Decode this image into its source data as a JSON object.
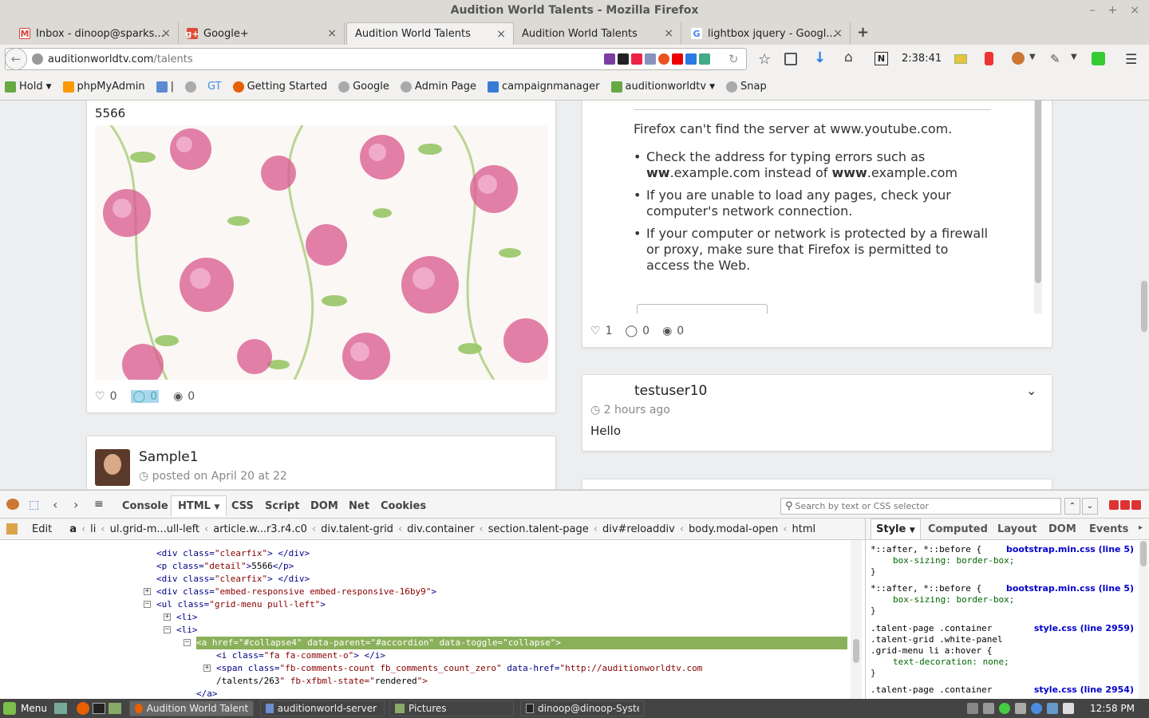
{
  "window": {
    "title": "Audition World Talents - Mozilla Firefox"
  },
  "tabs": [
    {
      "label": "Inbox - dinoop@sparks...",
      "icon": "gmail-icon",
      "color": "#d44638",
      "glyph": "M"
    },
    {
      "label": "Google+",
      "icon": "google-plus-icon",
      "color": "#dd4b39",
      "glyph": "G"
    },
    {
      "label": "Audition World Talents",
      "icon": "",
      "color": "",
      "glyph": ""
    },
    {
      "label": "Audition World Talents",
      "icon": "",
      "color": "",
      "glyph": ""
    },
    {
      "label": "lightbox jquery - Googl...",
      "icon": "google-icon",
      "color": "#4285f4",
      "glyph": "G"
    }
  ],
  "navbar": {
    "url_host": "auditionworldtv.com",
    "url_path": "/talents",
    "clock": "2:38:41"
  },
  "bookmarks": [
    "Hold",
    "phpMyAdmin",
    "GT",
    "Getting Started",
    "Google",
    "Admin Page",
    "campaignmanager",
    "auditionworldtv",
    "Snap"
  ],
  "content": {
    "post1": {
      "detail": "5566",
      "likes": "0",
      "comments": "0",
      "views": "0"
    },
    "error": {
      "heading": "Firefox can't find the server at www.youtube.com.",
      "bullets": [
        [
          "Check the address for typing errors such as ",
          "ww",
          ".example.com instead of ",
          "www",
          ".example.com"
        ],
        [
          "If you are unable to load any pages, check your computer's network connection."
        ],
        [
          "If your computer or network is protected by a firewall or proxy, make sure that Firefox is permitted to access the Web."
        ]
      ],
      "likes": "1",
      "comments": "0",
      "views": "0"
    },
    "post2": {
      "user": "testuser10",
      "time": "2 hours ago",
      "body": "Hello"
    },
    "post3": {
      "user": "Sample1",
      "time": "posted on April 20 at 22"
    }
  },
  "devtools": {
    "tabs": [
      "Console",
      "HTML",
      "CSS",
      "Script",
      "DOM",
      "Net",
      "Cookies"
    ],
    "search_placeholder": "Search by text or CSS selector",
    "edit_label": "Edit",
    "breadcrumbs": [
      "a",
      "li",
      "ul.grid-m...ull-left",
      "article.w...r3.r4.c0",
      "div.talent-grid",
      "div.container",
      "section.talent-page",
      "div#reloaddiv",
      "body.modal-open",
      "html"
    ],
    "side_tabs": [
      "Style",
      "Computed",
      "Layout",
      "DOM",
      "Events"
    ],
    "html_lines": [
      {
        "indent": 196,
        "tog": "",
        "code": "<div class=\"clearfix\"> </div>"
      },
      {
        "indent": 196,
        "tog": "",
        "code": "<p class=\"detail\">5566</p>"
      },
      {
        "indent": 196,
        "tog": "",
        "code": "<div class=\"clearfix\"> </div>"
      },
      {
        "indent": 196,
        "tog": "+",
        "code": "<div class=\"embed-responsive embed-responsive-16by9\">"
      },
      {
        "indent": 196,
        "tog": "-",
        "code": "<ul class=\"grid-menu pull-left\">"
      },
      {
        "indent": 221,
        "tog": "+",
        "code": "<li>"
      },
      {
        "indent": 221,
        "tog": "-",
        "code": "<li>"
      },
      {
        "indent": 246,
        "tog": "-",
        "code": "<a href=\"#collapse4\" data-parent=\"#accordion\" data-toggle=\"collapse\">",
        "selected": true
      },
      {
        "indent": 271,
        "tog": "",
        "code": "<i class=\"fa fa-comment-o\"> </i>"
      },
      {
        "indent": 271,
        "tog": "+",
        "code": "<span class=\"fb-comments-count fb_comments_count_zero\" data-href=\"http://auditionworldtv.com"
      },
      {
        "indent": 271,
        "tog": "",
        "code": "/talents/263\" fb-xfbml-state=\"rendered\">"
      },
      {
        "indent": 246,
        "tog": "",
        "code": "</a>"
      },
      {
        "indent": 221,
        "tog": "",
        "code": "</li>"
      }
    ],
    "css_rules": [
      {
        "selector": "*::after, *::before {",
        "source": "bootstrap.min.css (line 5)",
        "props": [
          "box-sizing: border-box;"
        ]
      },
      {
        "selector": "*::after, *::before {",
        "source": "bootstrap.min.css (line 5)",
        "props": [
          "box-sizing: border-box;"
        ]
      },
      {
        "selector": ".talent-page .container",
        "selector2": ".talent-grid .white-panel",
        "selector3": ".grid-menu li a:hover {",
        "source": "style.css (line 2959)",
        "props": [
          "text-decoration: none;"
        ]
      },
      {
        "selector": ".talent-page .container",
        "source": "style.css (line 2954)",
        "props": []
      }
    ]
  },
  "taskbar": {
    "menu": "Menu",
    "items": [
      "Audition World Talents - ...",
      "auditionworld-server - N...",
      "Pictures",
      "dinoop@dinoop-System-..."
    ],
    "clock": "12:58 PM"
  }
}
